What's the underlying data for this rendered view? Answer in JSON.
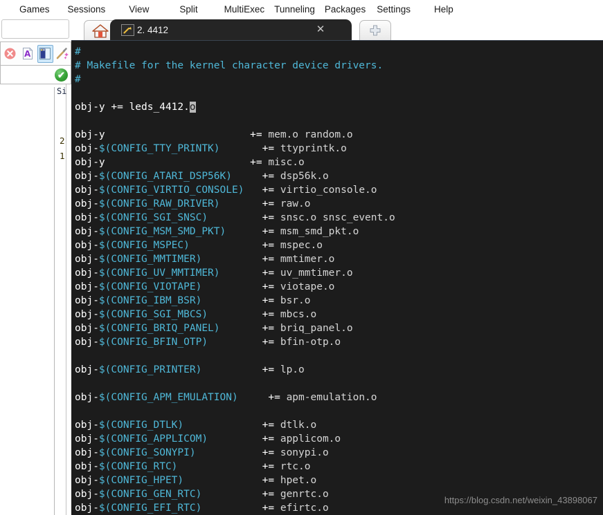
{
  "menubar": {
    "items": [
      {
        "label": "Games"
      },
      {
        "label": "Sessions"
      },
      {
        "label": "View"
      },
      {
        "label": "Split"
      },
      {
        "label": "MultiExec"
      },
      {
        "label": "Tunneling"
      },
      {
        "label": "Packages"
      },
      {
        "label": "Settings"
      },
      {
        "label": "Help"
      }
    ]
  },
  "left_panel": {
    "search_value": "",
    "toolbar_icons": [
      {
        "name": "close-red-icon",
        "glyph": "✕"
      },
      {
        "name": "font-a-icon",
        "glyph": "A"
      },
      {
        "name": "panel-layout-icon",
        "glyph": ""
      },
      {
        "name": "magic-wand-icon",
        "glyph": ""
      }
    ],
    "status_check": "✔",
    "side_label": "Si",
    "numbers": [
      "2",
      "1"
    ]
  },
  "tabs": {
    "home_icon": "home-icon",
    "active": {
      "label": "2. 4412",
      "icon": "terminal-key-icon",
      "close_glyph": "✕"
    },
    "new_tab_glyph": "✚"
  },
  "terminal": {
    "watermark": "https://blog.csdn.net/weixin_43898067",
    "lines": [
      [
        {
          "t": "#",
          "c": "c-comment"
        }
      ],
      [
        {
          "t": "# Makefile for the kernel character device drivers.",
          "c": "c-comment"
        }
      ],
      [
        {
          "t": "#",
          "c": "c-comment"
        }
      ],
      [],
      [
        {
          "t": "obj-y += leds_4412.",
          "c": "c-var"
        },
        {
          "t": "o",
          "c": "c-cursor"
        }
      ],
      [],
      [
        {
          "t": "obj-y",
          "c": "c-var"
        },
        {
          "t": "                        ",
          "c": "c-val"
        },
        {
          "t": "+=",
          "c": "c-op"
        },
        {
          "t": " mem.o random.o",
          "c": "c-val"
        }
      ],
      [
        {
          "t": "obj-",
          "c": "c-var"
        },
        {
          "t": "$(CONFIG_TTY_PRINTK)",
          "c": "c-cfg"
        },
        {
          "t": "       ",
          "c": "c-val"
        },
        {
          "t": "+=",
          "c": "c-op"
        },
        {
          "t": " ttyprintk.o",
          "c": "c-val"
        }
      ],
      [
        {
          "t": "obj-y",
          "c": "c-var"
        },
        {
          "t": "                        ",
          "c": "c-val"
        },
        {
          "t": "+=",
          "c": "c-op"
        },
        {
          "t": " misc.o",
          "c": "c-val"
        }
      ],
      [
        {
          "t": "obj-",
          "c": "c-var"
        },
        {
          "t": "$(CONFIG_ATARI_DSP56K)",
          "c": "c-cfg"
        },
        {
          "t": "     ",
          "c": "c-val"
        },
        {
          "t": "+=",
          "c": "c-op"
        },
        {
          "t": " dsp56k.o",
          "c": "c-val"
        }
      ],
      [
        {
          "t": "obj-",
          "c": "c-var"
        },
        {
          "t": "$(CONFIG_VIRTIO_CONSOLE)",
          "c": "c-cfg"
        },
        {
          "t": "   ",
          "c": "c-val"
        },
        {
          "t": "+=",
          "c": "c-op"
        },
        {
          "t": " virtio_console.o",
          "c": "c-val"
        }
      ],
      [
        {
          "t": "obj-",
          "c": "c-var"
        },
        {
          "t": "$(CONFIG_RAW_DRIVER)",
          "c": "c-cfg"
        },
        {
          "t": "       ",
          "c": "c-val"
        },
        {
          "t": "+=",
          "c": "c-op"
        },
        {
          "t": " raw.o",
          "c": "c-val"
        }
      ],
      [
        {
          "t": "obj-",
          "c": "c-var"
        },
        {
          "t": "$(CONFIG_SGI_SNSC)",
          "c": "c-cfg"
        },
        {
          "t": "         ",
          "c": "c-val"
        },
        {
          "t": "+=",
          "c": "c-op"
        },
        {
          "t": " snsc.o snsc_event.o",
          "c": "c-val"
        }
      ],
      [
        {
          "t": "obj-",
          "c": "c-var"
        },
        {
          "t": "$(CONFIG_MSM_SMD_PKT)",
          "c": "c-cfg"
        },
        {
          "t": "      ",
          "c": "c-val"
        },
        {
          "t": "+=",
          "c": "c-op"
        },
        {
          "t": " msm_smd_pkt.o",
          "c": "c-val"
        }
      ],
      [
        {
          "t": "obj-",
          "c": "c-var"
        },
        {
          "t": "$(CONFIG_MSPEC)",
          "c": "c-cfg"
        },
        {
          "t": "            ",
          "c": "c-val"
        },
        {
          "t": "+=",
          "c": "c-op"
        },
        {
          "t": " mspec.o",
          "c": "c-val"
        }
      ],
      [
        {
          "t": "obj-",
          "c": "c-var"
        },
        {
          "t": "$(CONFIG_MMTIMER)",
          "c": "c-cfg"
        },
        {
          "t": "          ",
          "c": "c-val"
        },
        {
          "t": "+=",
          "c": "c-op"
        },
        {
          "t": " mmtimer.o",
          "c": "c-val"
        }
      ],
      [
        {
          "t": "obj-",
          "c": "c-var"
        },
        {
          "t": "$(CONFIG_UV_MMTIMER)",
          "c": "c-cfg"
        },
        {
          "t": "       ",
          "c": "c-val"
        },
        {
          "t": "+=",
          "c": "c-op"
        },
        {
          "t": " uv_mmtimer.o",
          "c": "c-val"
        }
      ],
      [
        {
          "t": "obj-",
          "c": "c-var"
        },
        {
          "t": "$(CONFIG_VIOTAPE)",
          "c": "c-cfg"
        },
        {
          "t": "          ",
          "c": "c-val"
        },
        {
          "t": "+=",
          "c": "c-op"
        },
        {
          "t": " viotape.o",
          "c": "c-val"
        }
      ],
      [
        {
          "t": "obj-",
          "c": "c-var"
        },
        {
          "t": "$(CONFIG_IBM_BSR)",
          "c": "c-cfg"
        },
        {
          "t": "          ",
          "c": "c-val"
        },
        {
          "t": "+=",
          "c": "c-op"
        },
        {
          "t": " bsr.o",
          "c": "c-val"
        }
      ],
      [
        {
          "t": "obj-",
          "c": "c-var"
        },
        {
          "t": "$(CONFIG_SGI_MBCS)",
          "c": "c-cfg"
        },
        {
          "t": "         ",
          "c": "c-val"
        },
        {
          "t": "+=",
          "c": "c-op"
        },
        {
          "t": " mbcs.o",
          "c": "c-val"
        }
      ],
      [
        {
          "t": "obj-",
          "c": "c-var"
        },
        {
          "t": "$(CONFIG_BRIQ_PANEL)",
          "c": "c-cfg"
        },
        {
          "t": "       ",
          "c": "c-val"
        },
        {
          "t": "+=",
          "c": "c-op"
        },
        {
          "t": " briq_panel.o",
          "c": "c-val"
        }
      ],
      [
        {
          "t": "obj-",
          "c": "c-var"
        },
        {
          "t": "$(CONFIG_BFIN_OTP)",
          "c": "c-cfg"
        },
        {
          "t": "         ",
          "c": "c-val"
        },
        {
          "t": "+=",
          "c": "c-op"
        },
        {
          "t": " bfin-otp.o",
          "c": "c-val"
        }
      ],
      [],
      [
        {
          "t": "obj-",
          "c": "c-var"
        },
        {
          "t": "$(CONFIG_PRINTER)",
          "c": "c-cfg"
        },
        {
          "t": "          ",
          "c": "c-val"
        },
        {
          "t": "+=",
          "c": "c-op"
        },
        {
          "t": " lp.o",
          "c": "c-val"
        }
      ],
      [],
      [
        {
          "t": "obj-",
          "c": "c-var"
        },
        {
          "t": "$(CONFIG_APM_EMULATION)",
          "c": "c-cfg"
        },
        {
          "t": "     ",
          "c": "c-val"
        },
        {
          "t": "+=",
          "c": "c-op"
        },
        {
          "t": " apm-emulation.o",
          "c": "c-val"
        }
      ],
      [],
      [
        {
          "t": "obj-",
          "c": "c-var"
        },
        {
          "t": "$(CONFIG_DTLK)",
          "c": "c-cfg"
        },
        {
          "t": "             ",
          "c": "c-val"
        },
        {
          "t": "+=",
          "c": "c-op"
        },
        {
          "t": " dtlk.o",
          "c": "c-val"
        }
      ],
      [
        {
          "t": "obj-",
          "c": "c-var"
        },
        {
          "t": "$(CONFIG_APPLICOM)",
          "c": "c-cfg"
        },
        {
          "t": "         ",
          "c": "c-val"
        },
        {
          "t": "+=",
          "c": "c-op"
        },
        {
          "t": " applicom.o",
          "c": "c-val"
        }
      ],
      [
        {
          "t": "obj-",
          "c": "c-var"
        },
        {
          "t": "$(CONFIG_SONYPI)",
          "c": "c-cfg"
        },
        {
          "t": "           ",
          "c": "c-val"
        },
        {
          "t": "+=",
          "c": "c-op"
        },
        {
          "t": " sonypi.o",
          "c": "c-val"
        }
      ],
      [
        {
          "t": "obj-",
          "c": "c-var"
        },
        {
          "t": "$(CONFIG_RTC)",
          "c": "c-cfg"
        },
        {
          "t": "              ",
          "c": "c-val"
        },
        {
          "t": "+=",
          "c": "c-op"
        },
        {
          "t": " rtc.o",
          "c": "c-val"
        }
      ],
      [
        {
          "t": "obj-",
          "c": "c-var"
        },
        {
          "t": "$(CONFIG_HPET)",
          "c": "c-cfg"
        },
        {
          "t": "             ",
          "c": "c-val"
        },
        {
          "t": "+=",
          "c": "c-op"
        },
        {
          "t": " hpet.o",
          "c": "c-val"
        }
      ],
      [
        {
          "t": "obj-",
          "c": "c-var"
        },
        {
          "t": "$(CONFIG_GEN_RTC)",
          "c": "c-cfg"
        },
        {
          "t": "          ",
          "c": "c-val"
        },
        {
          "t": "+=",
          "c": "c-op"
        },
        {
          "t": " genrtc.o",
          "c": "c-val"
        }
      ],
      [
        {
          "t": "obj-",
          "c": "c-var"
        },
        {
          "t": "$(CONFIG_EFI_RTC)",
          "c": "c-cfg"
        },
        {
          "t": "          ",
          "c": "c-val"
        },
        {
          "t": "+=",
          "c": "c-op"
        },
        {
          "t": " efirtc.o",
          "c": "c-val"
        }
      ]
    ]
  },
  "colors": {
    "terminal_bg": "#1c1c1c",
    "comment": "#4fb8d8",
    "config_var": "#4fb8d8",
    "value": "#d6d6d6",
    "operator": "#ffffff",
    "tab_active_bg": "#252525",
    "selected_tool_bg": "#cfe8f9"
  }
}
